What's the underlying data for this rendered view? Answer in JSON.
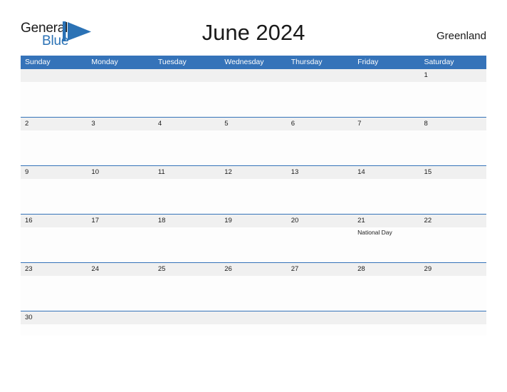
{
  "brand": {
    "name_part1": "General",
    "name_part2": "Blue",
    "mark_name": "triangle-flag-mark",
    "color_dark": "#1a1a1a",
    "color_blue": "#2b72b5"
  },
  "header": {
    "title": "June 2024",
    "location": "Greenland"
  },
  "theme": {
    "header_blue": "#3573b9",
    "separator_blue": "#3573b9",
    "daynum_band": "#f0f0f0",
    "cell_background": "#fdfdfd",
    "text_dark": "#1a1a1a",
    "text_light": "#ffffff"
  },
  "calendar": {
    "weekdays": [
      "Sunday",
      "Monday",
      "Tuesday",
      "Wednesday",
      "Thursday",
      "Friday",
      "Saturday"
    ],
    "weeks": [
      {
        "days": [
          {
            "num": "",
            "event": ""
          },
          {
            "num": "",
            "event": ""
          },
          {
            "num": "",
            "event": ""
          },
          {
            "num": "",
            "event": ""
          },
          {
            "num": "",
            "event": ""
          },
          {
            "num": "",
            "event": ""
          },
          {
            "num": "1",
            "event": ""
          }
        ]
      },
      {
        "days": [
          {
            "num": "2",
            "event": ""
          },
          {
            "num": "3",
            "event": ""
          },
          {
            "num": "4",
            "event": ""
          },
          {
            "num": "5",
            "event": ""
          },
          {
            "num": "6",
            "event": ""
          },
          {
            "num": "7",
            "event": ""
          },
          {
            "num": "8",
            "event": ""
          }
        ]
      },
      {
        "days": [
          {
            "num": "9",
            "event": ""
          },
          {
            "num": "10",
            "event": ""
          },
          {
            "num": "11",
            "event": ""
          },
          {
            "num": "12",
            "event": ""
          },
          {
            "num": "13",
            "event": ""
          },
          {
            "num": "14",
            "event": ""
          },
          {
            "num": "15",
            "event": ""
          }
        ]
      },
      {
        "days": [
          {
            "num": "16",
            "event": ""
          },
          {
            "num": "17",
            "event": ""
          },
          {
            "num": "18",
            "event": ""
          },
          {
            "num": "19",
            "event": ""
          },
          {
            "num": "20",
            "event": ""
          },
          {
            "num": "21",
            "event": "National Day"
          },
          {
            "num": "22",
            "event": ""
          }
        ]
      },
      {
        "days": [
          {
            "num": "23",
            "event": ""
          },
          {
            "num": "24",
            "event": ""
          },
          {
            "num": "25",
            "event": ""
          },
          {
            "num": "26",
            "event": ""
          },
          {
            "num": "27",
            "event": ""
          },
          {
            "num": "28",
            "event": ""
          },
          {
            "num": "29",
            "event": ""
          }
        ]
      },
      {
        "days": [
          {
            "num": "30",
            "event": ""
          },
          {
            "num": "",
            "event": ""
          },
          {
            "num": "",
            "event": ""
          },
          {
            "num": "",
            "event": ""
          },
          {
            "num": "",
            "event": ""
          },
          {
            "num": "",
            "event": ""
          },
          {
            "num": "",
            "event": ""
          }
        ]
      }
    ]
  }
}
